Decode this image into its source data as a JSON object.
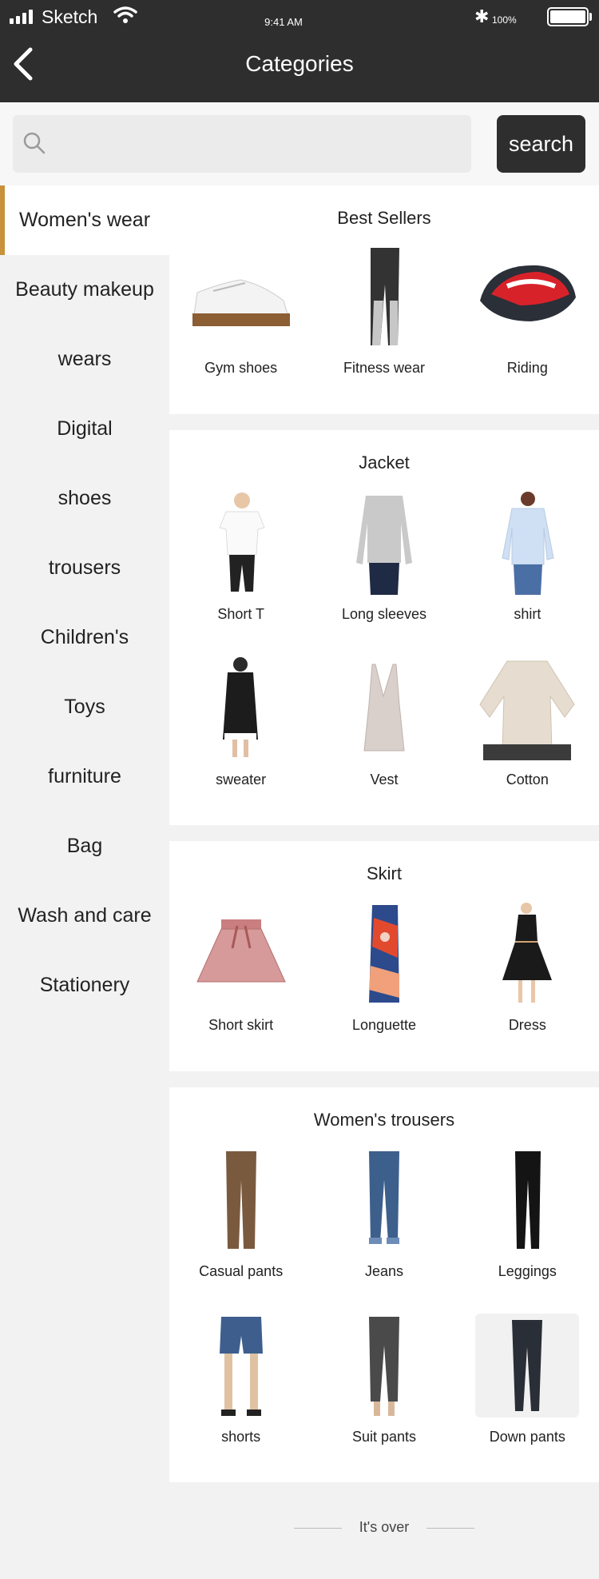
{
  "status": {
    "carrier": "Sketch",
    "time": "9:41 AM",
    "battery": "100%"
  },
  "header": {
    "title": "Categories"
  },
  "search": {
    "placeholder": "",
    "button": "search"
  },
  "sidebar": {
    "items": [
      {
        "label": "Women's wear"
      },
      {
        "label": "Beauty makeup"
      },
      {
        "label": "wears"
      },
      {
        "label": "Digital"
      },
      {
        "label": "shoes"
      },
      {
        "label": "trousers"
      },
      {
        "label": "Children's"
      },
      {
        "label": "Toys"
      },
      {
        "label": "furniture"
      },
      {
        "label": "Bag"
      },
      {
        "label": "Wash and care"
      },
      {
        "label": "Stationery"
      }
    ]
  },
  "sections": [
    {
      "title": "Best Sellers",
      "items": [
        {
          "label": "Gym shoes"
        },
        {
          "label": "Fitness wear"
        },
        {
          "label": "Riding"
        }
      ]
    },
    {
      "title": "Jacket",
      "items": [
        {
          "label": "Short T"
        },
        {
          "label": "Long sleeves"
        },
        {
          "label": "shirt"
        },
        {
          "label": "sweater"
        },
        {
          "label": "Vest"
        },
        {
          "label": "Cotton"
        }
      ]
    },
    {
      "title": "Skirt",
      "items": [
        {
          "label": "Short skirt"
        },
        {
          "label": "Longuette"
        },
        {
          "label": "Dress"
        }
      ]
    },
    {
      "title": "Women's trousers",
      "items": [
        {
          "label": "Casual pants"
        },
        {
          "label": "Jeans"
        },
        {
          "label": "Leggings"
        },
        {
          "label": "shorts"
        },
        {
          "label": "Suit pants"
        },
        {
          "label": "Down pants"
        }
      ]
    }
  ],
  "footer": {
    "text": "It's over"
  },
  "colors": {
    "header_bg": "#2e2e2e",
    "accent": "#c8913a",
    "page_bg": "#f2f2f2"
  }
}
